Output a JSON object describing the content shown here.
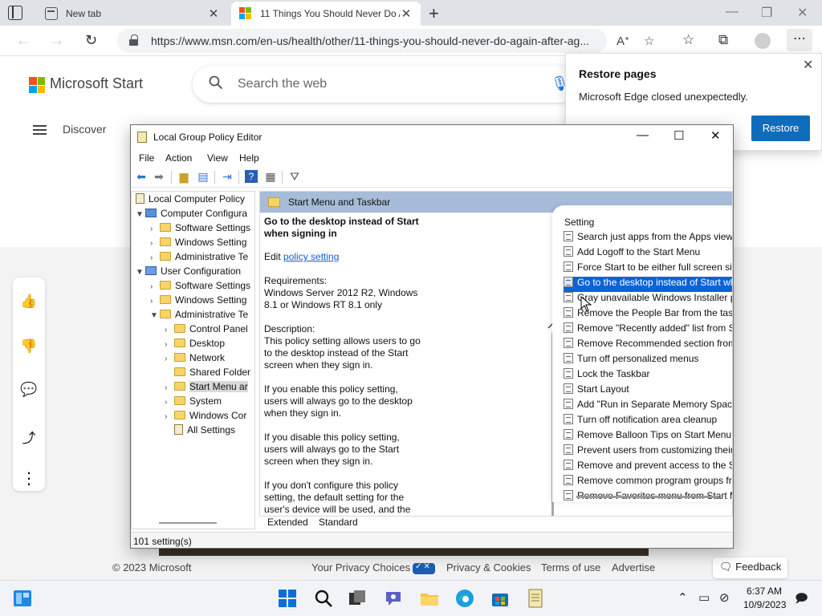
{
  "browser": {
    "tabs": [
      {
        "label": "New tab",
        "active": false
      },
      {
        "label": "11 Things You Should Never Do Again After Age 50",
        "active": true
      }
    ],
    "url": "https://www.msn.com/en-us/health/other/11-things-you-should-never-do-again-after-ag..."
  },
  "restore_popup": {
    "title": "Restore pages",
    "message": "Microsoft Edge closed unexpectedly.",
    "button": "Restore"
  },
  "msn": {
    "brand": "Microsoft Start",
    "search_placeholder": "Search the web",
    "discover": "Discover",
    "footer": {
      "copyright": "© 2023 Microsoft",
      "privacy_choices": "Your Privacy Choices",
      "privacy_cookies": "Privacy & Cookies",
      "terms": "Terms of use",
      "advertise": "Advertise",
      "feedback": "Feedback"
    }
  },
  "gpe": {
    "title": "Local Group Policy Editor",
    "menu": [
      "File",
      "Action",
      "View",
      "Help"
    ],
    "tree": {
      "root": "Local Computer Policy",
      "computer_config": "Computer Configura",
      "cc_software": "Software Settings",
      "cc_windows": "Windows Setting",
      "cc_admin": "Administrative Te",
      "user_config": "User Configuration",
      "uc_software": "Software Settings",
      "uc_windows": "Windows Setting",
      "uc_admin": "Administrative Te",
      "control_panel": "Control Panel",
      "desktop": "Desktop",
      "network": "Network",
      "shared_folders": "Shared Folder",
      "start_menu": "Start Menu ar",
      "system": "System",
      "windows_comp": "Windows Cor",
      "all_settings": "All Settings"
    },
    "pane_header": "Start Menu and Taskbar",
    "description": {
      "title": "Go to the desktop instead of Start when signing in",
      "edit_prefix": "Edit",
      "edit_link": "policy setting",
      "requirements_label": "Requirements:",
      "requirements": "Windows Server 2012 R2, Windows 8.1 or Windows RT 8.1 only",
      "description_label": "Description:",
      "p1": "This policy setting allows users to go to the desktop instead of the Start screen when they sign in.",
      "p2": "If you enable this policy setting, users will always go to the desktop when they sign in.",
      "p3": "If you disable this policy setting, users will always go to the Start screen when they sign in.",
      "p4": "If you don't configure this policy setting, the default setting for the user's device will be used, and the"
    },
    "column_header": "Setting",
    "settings": [
      "Search just apps from the Apps view",
      "Add Logoff to the Start Menu",
      "Force Start to be either full screen size or menu size",
      "Go to the desktop instead of Start when signing in",
      "Gray unavailable Windows Installer programs Start Menu sh...",
      "Remove the People Bar from the taskbar",
      "Remove \"Recently added\" list from Start Menu",
      "Remove Recommended section from Start Menu",
      "Turn off personalized menus",
      "Lock the Taskbar",
      "Start Layout",
      "Add \"Run in Separate Memory Space\" check box to Run dial...",
      "Turn off notification area cleanup",
      "Remove Balloon Tips on Start Menu items",
      "Prevent users from customizing their Start Screen",
      "Remove and prevent access to the Shut Down, Restart, Sleep...",
      "Remove common program groups from Start Menu",
      "Remove Favorites menu from Start Menu"
    ],
    "selected_setting_index": 3,
    "bottom_tabs": [
      "Extended",
      "Standard"
    ],
    "status": "101 setting(s)"
  },
  "taskbar": {
    "time": "6:37 AM",
    "date": "10/9/2023"
  }
}
